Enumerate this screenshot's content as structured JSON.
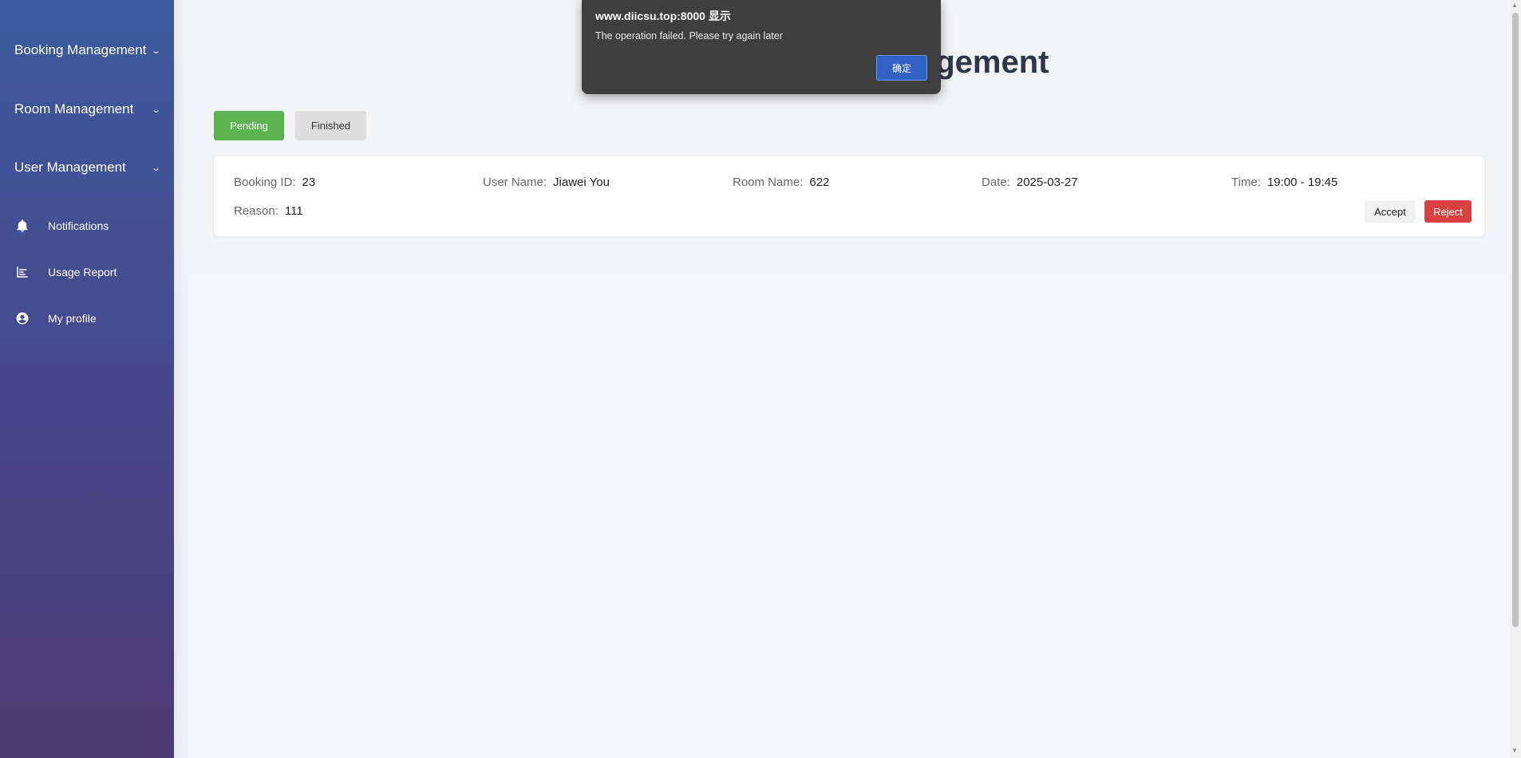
{
  "sidebar": {
    "groups": [
      {
        "label": "Booking Management"
      },
      {
        "label": "Room Management"
      },
      {
        "label": "User Management"
      }
    ],
    "items": [
      {
        "label": "Notifications",
        "icon": "bell-icon"
      },
      {
        "label": "Usage Report",
        "icon": "chart-icon"
      },
      {
        "label": "My profile",
        "icon": "user-circle-icon"
      }
    ],
    "chevron": "⌄"
  },
  "page": {
    "title": "agement"
  },
  "tabs": {
    "pending": "Pending",
    "finished": "Finished"
  },
  "booking": {
    "id_label": "Booking ID:",
    "id": "23",
    "user_label": "User Name:",
    "user": "Jiawei You",
    "room_label": "Room Name:",
    "room": "622",
    "date_label": "Date:",
    "date": "2025-03-27",
    "time_label": "Time:",
    "time": "19:00 - 19:45",
    "reason_label": "Reason:",
    "reason": "111",
    "accept": "Accept",
    "reject": "Reject"
  },
  "dialog": {
    "origin": "www.diicsu.top:8000 显示",
    "message": "The operation failed. Please try again later",
    "ok": "确定"
  },
  "colors": {
    "accent_green": "#5cb352",
    "reject_red": "#d94040",
    "dialog_button": "#2f62c4"
  }
}
